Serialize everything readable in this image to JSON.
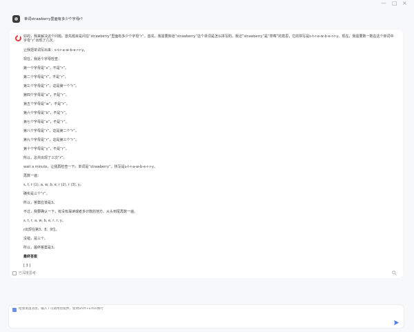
{
  "window": {
    "controls": [
      "—",
      "□",
      "×"
    ]
  },
  "user": {
    "question": "单词strawberry里面有多少个字母r?"
  },
  "answer": {
    "lines": [
      {
        "text": "好的，我来解决这个问题。首先题目是问在“strawberry”里面有多少个字母“r”。首先，我需要知道“strawberry”这个单词是怎么拼写的。我记“strawberry”是“草莓”的意思，它的拼写是s-t-r-a-w-b-e-r-r-y。现在，我需要数一数在这个单词中",
        "bold": false
      },
      {
        "text": "字母“r”出现了几次。",
        "bold": false
      },
      {
        "text": "让我把单词写出来：s-t-r-a-w-b-e-r-r-y。",
        "bold": false
      },
      {
        "text": "现在，我逐个字母检查：",
        "bold": false
      },
      {
        "text": "第一个字母是“s”，不是“r”。",
        "bold": false
      },
      {
        "text": "第二个字母是“t”，不是“r”。",
        "bold": false
      },
      {
        "text": "第三个字母是“r”，这是第一个“r”。",
        "bold": false
      },
      {
        "text": "第四个字母是“a”，不是“r”。",
        "bold": false
      },
      {
        "text": "第五个字母是“w”，不是“r”。",
        "bold": false
      },
      {
        "text": "第六个字母是“b”，不是“r”。",
        "bold": false
      },
      {
        "text": "第七个字母是“e”，不是“r”。",
        "bold": false
      },
      {
        "text": "第八个字母是“r”，这是第二个“r”。",
        "bold": false
      },
      {
        "text": "第九个字母是“r”，这是第三个“r”。",
        "bold": false
      },
      {
        "text": "第十个字母是“y”，不是“r”。",
        "bold": false
      },
      {
        "text": "所以，总共出现了三次“r”。",
        "bold": false
      },
      {
        "text": "wait a minute，让我再检查一下。单词是“strawberry”，拼写是s-t-r-a-w-b-e-r-r-y。",
        "bold": false
      },
      {
        "text": "再数一遍：",
        "bold": false
      },
      {
        "text": "s, t, r (1), a, w, b, e, r (2), r (3), y。",
        "bold": false
      },
      {
        "text": "确实是三个“r”。",
        "bold": false
      },
      {
        "text": "所以，答案应该是3。",
        "bold": false
      },
      {
        "text": "不过，我要确认一下，有没有漏读或者多计数的地方。从头到尾再数一遍。",
        "bold": false
      },
      {
        "text": "s, t, r, a, w, b, e, r, r, y。",
        "bold": false
      },
      {
        "text": "r出现在第3、8、9位。",
        "bold": false
      },
      {
        "text": "没错，是三个。",
        "bold": false
      },
      {
        "text": "所以，最终答案是3。",
        "bold": false
      },
      {
        "text": "最终答案",
        "bold": true
      },
      {
        "text": "[ 3 ]",
        "bold": false
      }
    ],
    "footer_label": "已深度思考"
  },
  "input": {
    "placeholder": "给我发送消息，输入 / 可调用智能体，使用Shift+Enter换行"
  },
  "colors": {
    "accent_red": "#e03a3a",
    "send_blue": "#4a7cf0",
    "page_bg": "#f7f8fa"
  }
}
